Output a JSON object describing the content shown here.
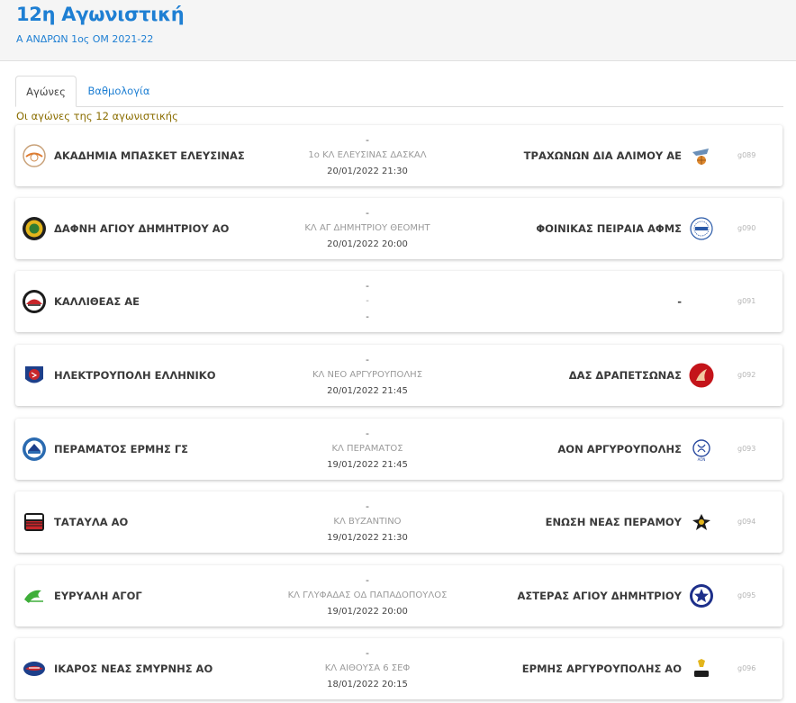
{
  "header": {
    "title": "12η Αγωνιστική",
    "subtitle": "Α ΑΝΔΡΩΝ 1ος ΟΜ 2021-22"
  },
  "tabs": [
    {
      "label": "Αγώνες",
      "active": true
    },
    {
      "label": "Βαθμολογία",
      "active": false
    }
  ],
  "note": "Οι αγώνες της 12 αγωνιστικής",
  "colors": {
    "accent": "#1e7fd3",
    "note": "#8a6d00"
  },
  "matches": [
    {
      "home": "ΑΚΑΔΗΜΙΑ ΜΠΑΣΚΕΤ ΕΛΕΥΣΙΝΑΣ",
      "score": "-",
      "venue": "1ο ΚΛ ΕΛΕΥΣΙΝΑΣ ΔΑΣΚΑΛ",
      "datetime": "20/01/2022 21:30",
      "away": "ΤΡΑΧΩΝΩΝ ΔΙΑ ΑΛΙΜΟΥ ΑΕ",
      "code": "g089",
      "home_icon": "akadimia-logo-icon",
      "away_icon": "trachones-logo-icon"
    },
    {
      "home": "ΔΑΦΝΗ ΑΓΙΟΥ ΔΗΜΗΤΡΙΟΥ ΑΟ",
      "score": "-",
      "venue": "ΚΛ ΑΓ ΔΗΜΗΤΡΙΟΥ ΘΕΟΜΗΤ",
      "datetime": "20/01/2022 20:00",
      "away": "ΦΟΙΝΙΚΑΣ ΠΕΙΡΑΙΑ ΑΦΜΣ",
      "code": "g090",
      "home_icon": "dafni-logo-icon",
      "away_icon": "foinikas-logo-icon"
    },
    {
      "home": "ΚΑΛΛΙΘΕΑΣ ΑΕ",
      "score": "-",
      "venue": "-",
      "datetime": "-",
      "away": "-",
      "code": "g091",
      "home_icon": "kallithea-logo-icon",
      "away_icon": ""
    },
    {
      "home": "ΗΛΕΚΤΡΟΥΠΟΛΗ ΕΛΛΗΝΙΚΟ",
      "score": "-",
      "venue": "ΚΛ ΝΕΟ ΑΡΓΥΡΟΥΠΟΛΗΣ",
      "datetime": "20/01/2022 21:45",
      "away": "ΔΑΣ ΔΡΑΠΕΤΣΩΝΑΣ",
      "code": "g092",
      "home_icon": "ilektroupoli-logo-icon",
      "away_icon": "drapetsona-logo-icon"
    },
    {
      "home": "ΠΕΡΑΜΑΤΟΣ ΕΡΜΗΣ ΓΣ",
      "score": "-",
      "venue": "ΚΛ ΠΕΡΑΜΑΤΟΣ",
      "datetime": "19/01/2022 21:45",
      "away": "ΑΟΝ ΑΡΓΥΡΟΥΠΟΛΗΣ",
      "code": "g093",
      "home_icon": "perama-logo-icon",
      "away_icon": "aon-logo-icon"
    },
    {
      "home": "ΤΑΤΑΥΛΑ ΑΟ",
      "score": "-",
      "venue": "ΚΛ ΒΥΖΑΝΤΙΝΟ",
      "datetime": "19/01/2022 21:30",
      "away": "ΕΝΩΣΗ ΝΕΑΣ ΠΕΡΑΜΟΥ",
      "code": "g094",
      "home_icon": "tatavla-logo-icon",
      "away_icon": "enosi-logo-icon"
    },
    {
      "home": "ΕΥΡΥΑΛΗ ΑΓΟΓ",
      "score": "-",
      "venue": "ΚΛ ΓΛΥΦΑΔΑΣ ΟΔ ΠΑΠΑΔΟΠΟΥΛΟΣ",
      "datetime": "19/01/2022 20:00",
      "away": "ΑΣΤΕΡΑΣ ΑΓΙΟΥ ΔΗΜΗΤΡΙΟΥ",
      "code": "g095",
      "home_icon": "evryali-logo-icon",
      "away_icon": "asteras-logo-icon"
    },
    {
      "home": "ΙΚΑΡΟΣ ΝΕΑΣ ΣΜΥΡΝΗΣ ΑΟ",
      "score": "-",
      "venue": "ΚΛ ΑΙΘΟΥΣΑ 6 ΣΕΦ",
      "datetime": "18/01/2022 20:15",
      "away": "ΕΡΜΗΣ ΑΡΓΥΡΟΥΠΟΛΗΣ ΑΟ",
      "code": "g096",
      "home_icon": "ikaros-logo-icon",
      "away_icon": "ermis-logo-icon"
    }
  ]
}
